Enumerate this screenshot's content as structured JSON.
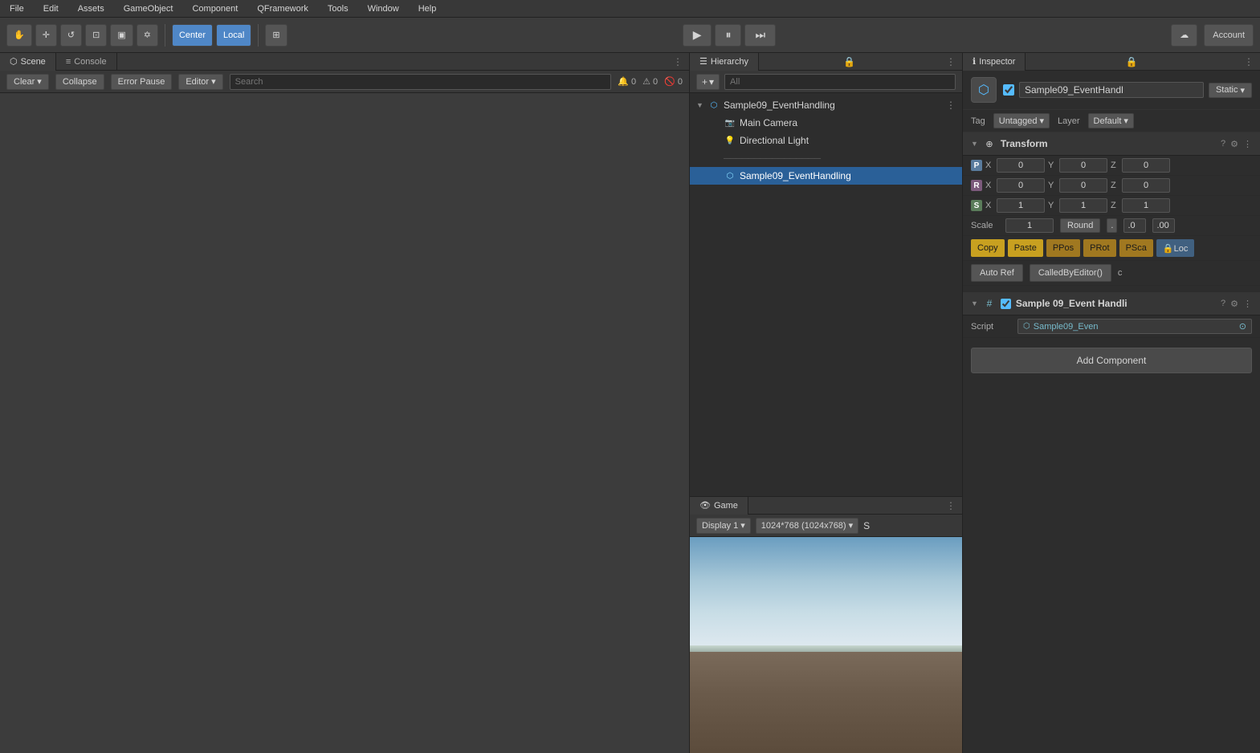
{
  "menu": {
    "items": [
      "File",
      "Edit",
      "Assets",
      "GameObject",
      "Component",
      "QFramework",
      "Tools",
      "Window",
      "Help"
    ]
  },
  "toolbar": {
    "hand_tool": "✋",
    "move_tool": "✛",
    "rotate_tool": "↺",
    "scale_tool": "⊡",
    "rect_tool": "▣",
    "transform_tool": "❖",
    "pivot_center": "Center",
    "pivot_local": "Local",
    "snap_btn": "⊞",
    "play_btn": "▶",
    "pause_btn": "⏸",
    "step_btn": "⏭",
    "cloud_label": "☁",
    "account_label": "Account"
  },
  "left_panel": {
    "tabs": [
      {
        "label": "Scene",
        "icon": "⬡",
        "active": true
      },
      {
        "label": "Console",
        "icon": "≡",
        "active": false
      }
    ],
    "console": {
      "clear_label": "Clear",
      "clear_arrow": "▾",
      "collapse_label": "Collapse",
      "error_pause_label": "Error Pause",
      "editor_label": "Editor",
      "editor_arrow": "▾",
      "search_placeholder": "Search",
      "log_count": "0",
      "warn_count": "0",
      "error_count": "0"
    }
  },
  "hierarchy": {
    "panel_title": "Hierarchy",
    "lock_icon": "🔒",
    "more_icon": "⋮",
    "add_btn": "+",
    "add_arrow": "▾",
    "search_placeholder": "All",
    "items": [
      {
        "label": "Sample09_EventHandling",
        "indent": 0,
        "icon": "cube",
        "expanded": true,
        "id": "root"
      },
      {
        "label": "Main Camera",
        "indent": 1,
        "icon": "camera",
        "id": "camera"
      },
      {
        "label": "Directional Light",
        "indent": 1,
        "icon": "light",
        "id": "light"
      },
      {
        "label": "────────────────",
        "indent": 1,
        "icon": "dash",
        "id": "separator"
      },
      {
        "label": "Sample09_EventHandling",
        "indent": 1,
        "icon": "cube",
        "selected": true,
        "id": "event"
      }
    ],
    "game_panel": {
      "title": "Game",
      "icon": "👁",
      "more_icon": "⋮",
      "display_label": "Display 1",
      "resolution_label": "1024*768 (1024x768)",
      "extra_label": "S"
    }
  },
  "inspector": {
    "title": "Inspector",
    "lock_icon": "🔒",
    "more_icon": "⋮",
    "object": {
      "name": "Sample09_EventHandl",
      "enabled": true,
      "static_label": "Static",
      "static_arrow": "▾",
      "tag_label": "Tag",
      "tag_value": "Untagged",
      "tag_arrow": "▾",
      "layer_label": "Layer",
      "layer_value": "Default",
      "layer_arrow": "▾"
    },
    "transform": {
      "title": "Transform",
      "help_icon": "?",
      "settings_icon": "⚙",
      "more_icon": "⋮",
      "position": {
        "label": "P",
        "x": "0",
        "y": "0",
        "z": "0"
      },
      "rotation": {
        "label": "R",
        "x": "0",
        "y": "0",
        "z": "0"
      },
      "scale": {
        "label": "S",
        "x": "1",
        "y": "1",
        "z": "1"
      },
      "scale_row": {
        "label": "Scale",
        "value": "1",
        "round_label": "Round",
        "dot_label": ".",
        "decimal1": ".0",
        "decimal2": ".00"
      },
      "actions": {
        "copy": "Copy",
        "paste": "Paste",
        "ppos": "PPos",
        "prot": "PRot",
        "psca": "PSca",
        "loc": "🔒Loc"
      },
      "autoref_label": "Auto Ref",
      "calledby_label": "CalledByEditor()",
      "c_label": "c"
    },
    "script_component": {
      "title": "Sample 09_Event Handli",
      "help_icon": "?",
      "settings_icon": "⚙",
      "more_icon": "⋮",
      "script_label": "Script",
      "script_name": "Sample09_Even",
      "script_icon": "⬡",
      "target_icon": "⊙"
    },
    "add_component_label": "Add Component"
  }
}
